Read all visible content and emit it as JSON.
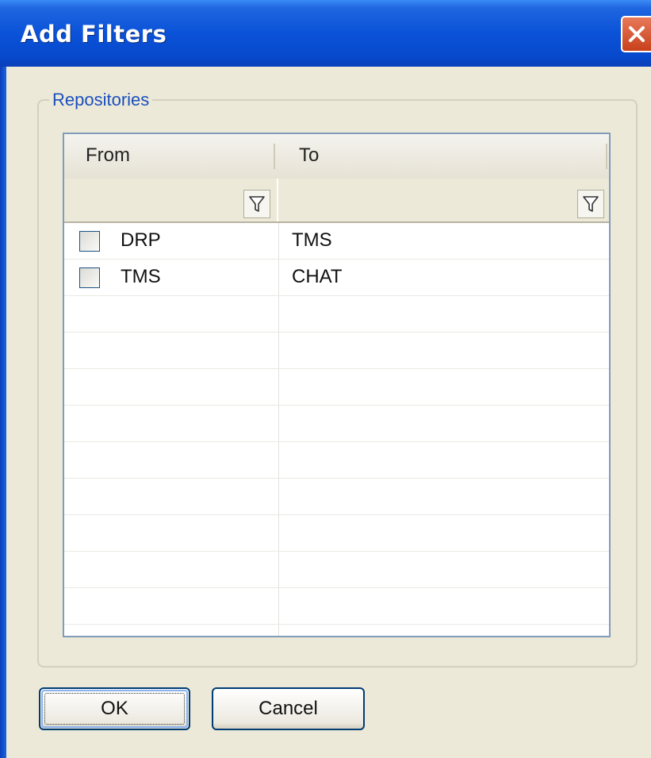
{
  "window": {
    "title": "Add Filters"
  },
  "group": {
    "label": "Repositories"
  },
  "grid": {
    "columns": [
      "From",
      "To"
    ],
    "rows": [
      {
        "from": "DRP",
        "to": "TMS",
        "checked": false
      },
      {
        "from": "TMS",
        "to": "CHAT",
        "checked": false
      }
    ],
    "empty_rows": 9
  },
  "buttons": {
    "ok": "OK",
    "cancel": "Cancel"
  },
  "icons": {
    "close": "close-icon",
    "filter": "filter-icon"
  }
}
